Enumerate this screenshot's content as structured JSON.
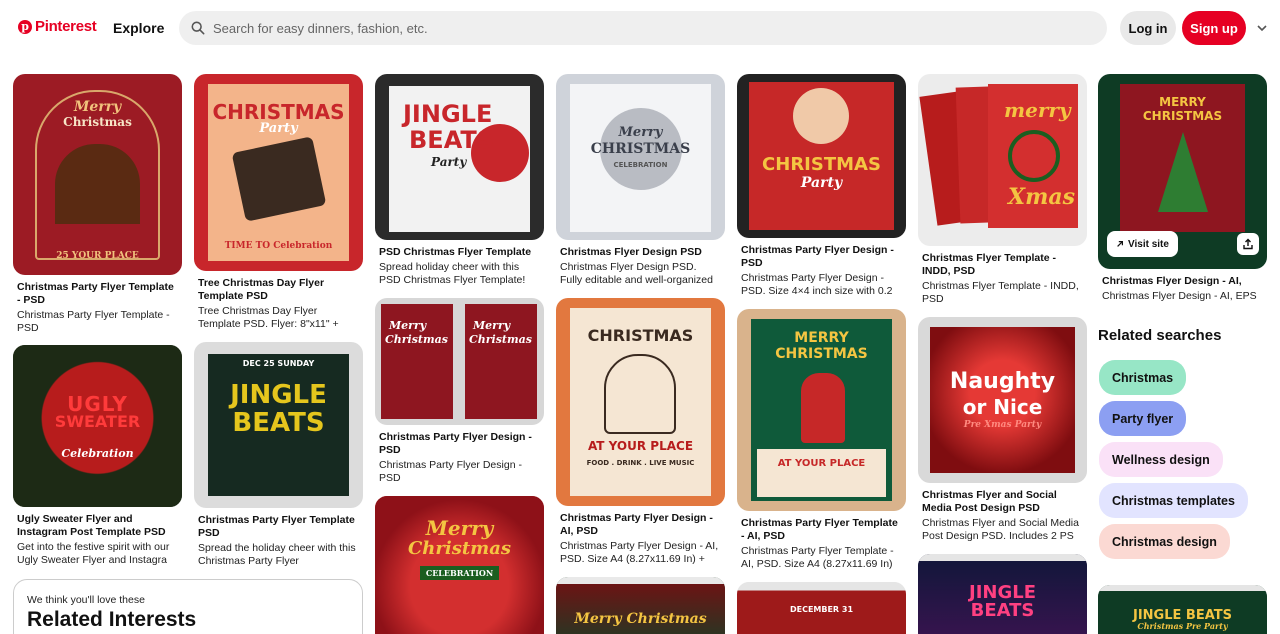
{
  "header": {
    "brand": "Pinterest",
    "explore": "Explore",
    "search_placeholder": "Search for easy dinners, fashion, etc.",
    "login": "Log in",
    "signup": "Sign up"
  },
  "pins": [
    {
      "title": "Christmas Party Flyer Template - PSD",
      "desc": "Christmas Party Flyer Template - PSD",
      "art": [
        "Merry",
        "Christmas",
        "25 YOUR PLACE"
      ]
    },
    {
      "title": "Tree Christmas Day Flyer Template PSD",
      "desc": "Tree Christmas Day Flyer Template PSD. Flyer: 8\"x11\" +",
      "art": [
        "CHRISTMAS",
        "Party",
        "TIME TO Celebration"
      ]
    },
    {
      "title": "PSD Christmas Flyer Template",
      "desc": "Spread holiday cheer with this PSD Christmas Flyer Template!",
      "art": [
        "JINGLE",
        "BEATS",
        "Party"
      ]
    },
    {
      "title": "Christmas Flyer Design PSD",
      "desc": "Christmas Flyer Design PSD. Fully editable and well-organized PS",
      "art": [
        "Merry",
        "CHRISTMAS",
        "CELEBRATION"
      ]
    },
    {
      "title": "Christmas Party Flyer Design - PSD",
      "desc": "Christmas Party Flyer Design - PSD. Size 4×4 inch size with 0.2",
      "art": [
        "CHRISTMAS",
        "Party"
      ]
    },
    {
      "title": "Christmas Flyer Template - INDD, PSD",
      "desc": "Christmas Flyer Template - INDD, PSD",
      "art": [
        "merry",
        "Xmas"
      ]
    },
    {
      "title": "Christmas Flyer Design - AI, EPS",
      "desc": "Christmas Flyer Design - AI, EPS",
      "visit": "Visit site",
      "art": [
        "MERRY",
        "CHRISTMAS"
      ]
    },
    {
      "title": "Ugly Sweater Flyer and Instagram Post Template PSD",
      "desc": "Get into the festive spirit with our Ugly Sweater Flyer and Instagra",
      "art": [
        "UGLY",
        "SWEATER",
        "Celebration"
      ]
    },
    {
      "title": "Christmas Party Flyer Template PSD",
      "desc": "Spread the holiday cheer with this Christmas Party Flyer",
      "art": [
        "DEC 25 SUNDAY",
        "JINGLE",
        "BEATS"
      ]
    },
    {
      "title": "Christmas Party Flyer Design - PSD",
      "desc": "Christmas Party Flyer Design - PSD",
      "art": [
        "Merry",
        "Christmas"
      ]
    },
    {
      "title": "Christmas Party Flyer Design - AI, PSD",
      "desc": "Christmas Party Flyer Design - AI, PSD. Size A4 (8.27x11.69 In) +",
      "art": [
        "CHRISTMAS",
        "AT YOUR PLACE",
        "FOOD . DRINK . LIVE MUSIC"
      ]
    },
    {
      "title": "Christmas Party Flyer Template - AI, PSD",
      "desc": "Christmas Party Flyer Template - AI, PSD. Size A4 (8.27x11.69 In) ...",
      "art": [
        "MERRY",
        "CHRISTMAS",
        "AT YOUR PLACE"
      ]
    },
    {
      "title": "Christmas Flyer and Social Media Post Design PSD",
      "desc": "Christmas Flyer and Social Media Post Design PSD. Includes 2 PS",
      "art": [
        "Naughty",
        "or Nice",
        "Pre Xmas Party"
      ]
    },
    {
      "art": [
        "Merry",
        "Christmas",
        "CELEBRATION"
      ]
    },
    {
      "art": [
        "Merry Christmas"
      ]
    },
    {
      "art": [
        "DECEMBER 31"
      ]
    },
    {
      "art": [
        "JINGLE",
        "BEATS"
      ]
    },
    {
      "art": [
        "JINGLE BEATS",
        "Christmas Pre Party"
      ]
    }
  ],
  "related": {
    "title": "Related searches",
    "chips": [
      {
        "label": "Christmas",
        "color": "#97e6c6"
      },
      {
        "label": "Party flyer",
        "color": "#8c9ff2"
      },
      {
        "label": "Wellness design",
        "color": "#fae1f7"
      },
      {
        "label": "Christmas templates",
        "color": "#e2e4ff"
      },
      {
        "label": "Christmas design",
        "color": "#fbd9d3"
      }
    ]
  },
  "interests": {
    "kicker": "We think you'll love these",
    "heading": "Related Interests"
  },
  "colors": {
    "brand": "#e60023"
  }
}
